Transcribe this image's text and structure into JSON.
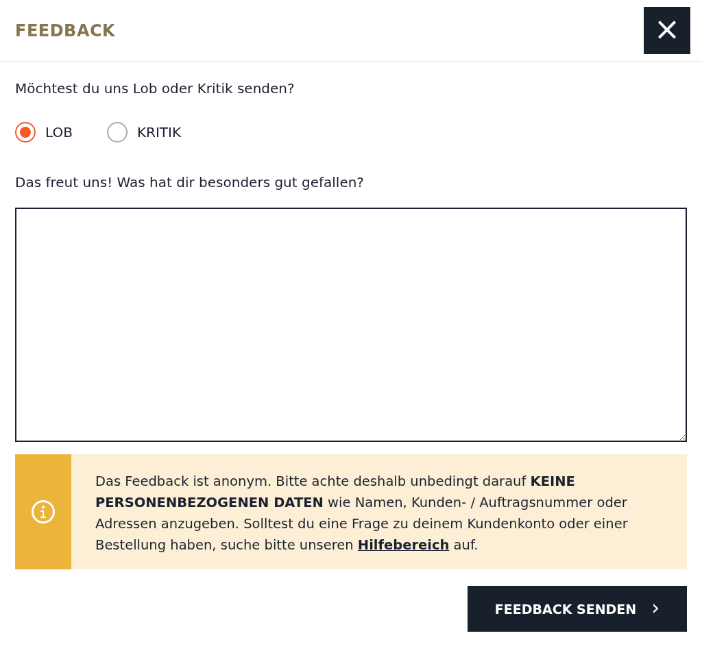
{
  "dialog": {
    "title": "FEEDBACK",
    "close": "×"
  },
  "question": "Möchtest du uns Lob oder Kritik senden?",
  "options": [
    {
      "label": "LOB",
      "selected": true
    },
    {
      "label": "KRITIK",
      "selected": false
    }
  ],
  "prompt": "Das freut uns! Was hat dir besonders gut gefallen?",
  "notice": {
    "text": "Das Feedback ist anonym. Bitte achte deshalb unbedingt darauf **KEINE PERSONENBEZOGENEN DATEN** wie Namen, Kunden- / Auftragsnummer oder Adressen anzugeben. Solltest du eine Frage zu deinem Kundenkonto oder einer Bestellung haben, suche bitte unseren ",
    "link": "Hilfebereich",
    "after": " auf."
  },
  "submit": {
    "label": "FEEDBACK SENDEN",
    "arrow": "›"
  }
}
